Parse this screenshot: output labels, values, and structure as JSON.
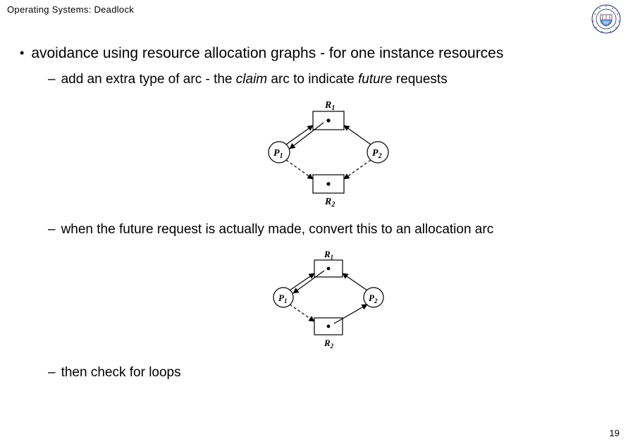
{
  "header": {
    "title": "Operating Systems: Deadlock"
  },
  "bullet": {
    "dot": "•",
    "text": "avoidance using resource allocation graphs  -   for one instance resources"
  },
  "sub1": {
    "dash": "–",
    "pre": "add an extra type of arc - the ",
    "claim": "claim",
    "mid": " arc to indicate ",
    "future": "future",
    "post": " requests"
  },
  "sub2": {
    "dash": "–",
    "text": "when the future request is actually made, convert this to an allocation arc"
  },
  "sub3": {
    "dash": "–",
    "text": "then check for loops"
  },
  "labels": {
    "R1": "R",
    "R1sub": "1",
    "R2": "R",
    "R2sub": "2",
    "P1": "P",
    "P1sub": "1",
    "P2": "P",
    "P2sub": "2"
  },
  "page": {
    "number": "19"
  }
}
